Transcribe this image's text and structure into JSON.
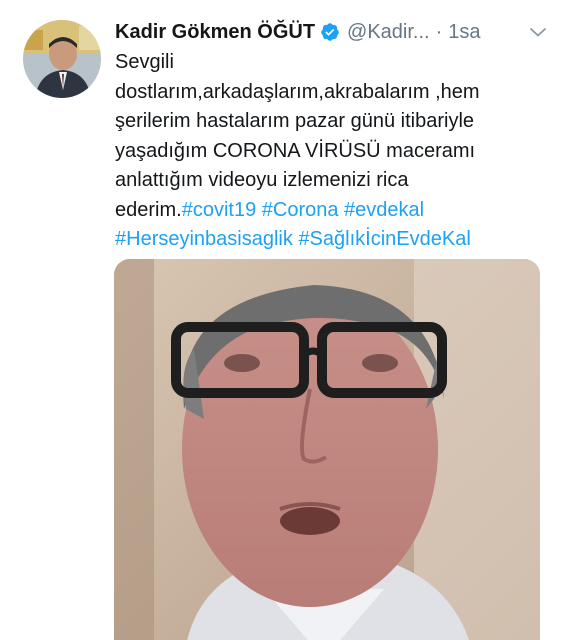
{
  "tweet": {
    "author": {
      "display_name": "Kadir Gökmen ÖĞÜT",
      "handle": "@Kadir...",
      "verified_icon": "verified-badge-icon"
    },
    "separator": "·",
    "time": "1sa",
    "menu_icon": "chevron-down-icon",
    "text": {
      "line1": "Sevgili",
      "line2": "dostlarım,arkadaşlarım,akrabalarım ,hem",
      "line3": "şerilerim hastalarım pazar günü itibariyle",
      "line4": "yaşadığım CORONA VİRÜSÜ maceramı",
      "line5": "anlattığım videoyu izlemenizi rica",
      "line6_prefix": "ederim.",
      "hashtags_line6": [
        "#covit19",
        "#Corona",
        "#evdekal"
      ],
      "hashtags_line7": [
        "#Herseyinbasisaglik",
        "#SağlıkİcinEvdeKal"
      ]
    },
    "media": {
      "type": "video",
      "accent_color": "#1da1f2"
    }
  }
}
